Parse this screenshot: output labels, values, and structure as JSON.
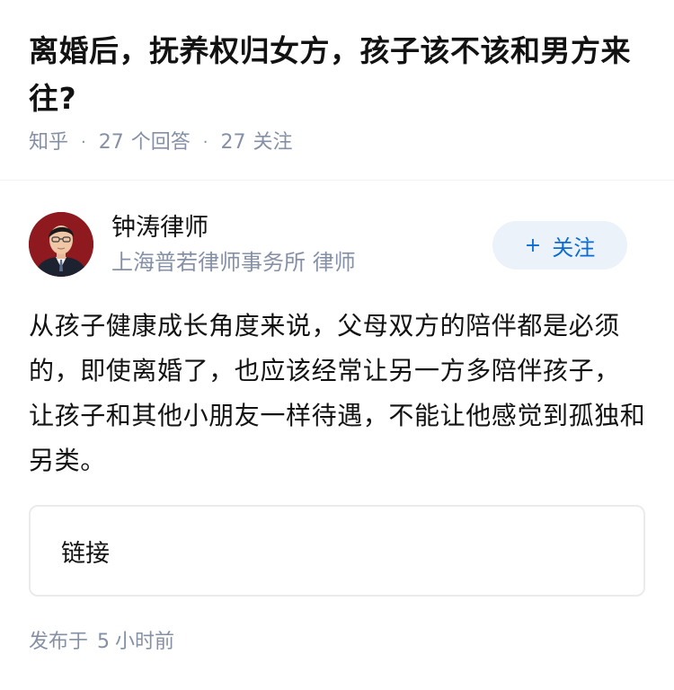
{
  "question": {
    "title": "离婚后，抚养权归女方，孩子该不该和男方来往?",
    "source": "知乎",
    "answer_count": "27",
    "answer_label": "个回答",
    "follower_count": "27",
    "follower_label": "关注"
  },
  "author": {
    "name": "钟涛律师",
    "headline": "上海普若律师事务所 律师",
    "follow_label": "关注",
    "follow_icon": "plus-icon"
  },
  "answer": {
    "content": "从孩子健康成长角度来说，父母双方的陪伴都是必须的，即使离婚了，也应该经常让另一方多陪伴孩子， 让孩子和其他小朋友一样待遇，不能让他感觉到孤独和另类。",
    "link_label": "链接",
    "published_prefix": "发布于",
    "published_value": "5",
    "published_suffix": "小时前"
  },
  "colors": {
    "meta_gray": "#8590a6",
    "follow_bg": "#ebf2fa",
    "follow_text": "#0b6bd3",
    "avatar_bg": "#8e1a1f"
  }
}
